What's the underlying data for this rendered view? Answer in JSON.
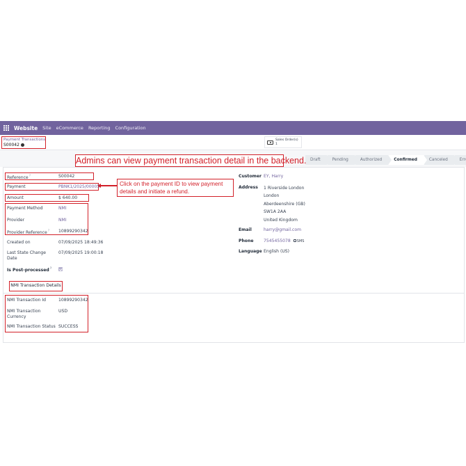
{
  "navbar": {
    "brand": "Website",
    "menu": [
      "Site",
      "eCommerce",
      "Reporting",
      "Configuration"
    ]
  },
  "breadcrumb": {
    "parent": "Payment Transactions",
    "current": "S00042"
  },
  "smart_button": {
    "label": "Sales Order(s)",
    "count": "1"
  },
  "statusbar": {
    "stages": [
      "Draft",
      "Pending",
      "Authorized",
      "Confirmed",
      "Canceled",
      "Error"
    ],
    "active": "Confirmed"
  },
  "annotations": {
    "title": "Admins can view payment transaction detail in the backend.",
    "payment_line1": "Click on the payment ID to view payment",
    "payment_line2": "details and initiate a refund."
  },
  "left_fields": [
    {
      "label": "Reference",
      "help": "?",
      "value": "S00042"
    },
    {
      "label": "Payment",
      "value": "PBNK1/2025/00005"
    },
    {
      "label": "Amount",
      "value": "$ 640.00"
    },
    {
      "label": "Payment Method",
      "value": "NMI"
    },
    {
      "label": "Provider",
      "value": "NMI"
    },
    {
      "label": "Provider Reference",
      "help": "?",
      "value": "10899290342"
    },
    {
      "label": "Created on",
      "value": "07/09/2025 18:49:36"
    },
    {
      "label": "Last State Change",
      "label2": "Date",
      "value": "07/09/2025 19:00:18"
    },
    {
      "label": "Is Post-processed",
      "help": "?"
    }
  ],
  "customer": {
    "customer_label": "Customer",
    "customer_value": "EY, Harry",
    "address_label": "Address",
    "address_lines": [
      "1 Riverside London",
      "London",
      "Aberdeenshire (GB)",
      "SW1A 2AA",
      "United Kingdom"
    ],
    "email_label": "Email",
    "email_value": "harry@gmail.com",
    "phone_label": "Phone",
    "phone_value": "7545455078",
    "sms_label": "SMS",
    "language_label": "Language",
    "language_value": "English (US)"
  },
  "tab": {
    "label": "NMI Transaction Details"
  },
  "nmi_fields": [
    {
      "label": "NMI Transaction Id",
      "value": "10899290342"
    },
    {
      "label": "NMI Transaction",
      "label2": "Currency",
      "value": "USD"
    },
    {
      "label": "NMI Transaction Status",
      "value": "SUCCESS"
    }
  ],
  "colors": {
    "navbar": "#71639e",
    "annotation": "#d21f28",
    "link": "#71639e"
  },
  "icons": [
    "apps-grid-icon",
    "gear-icon",
    "sales-order-icon",
    "sms-icon",
    "check-icon"
  ]
}
